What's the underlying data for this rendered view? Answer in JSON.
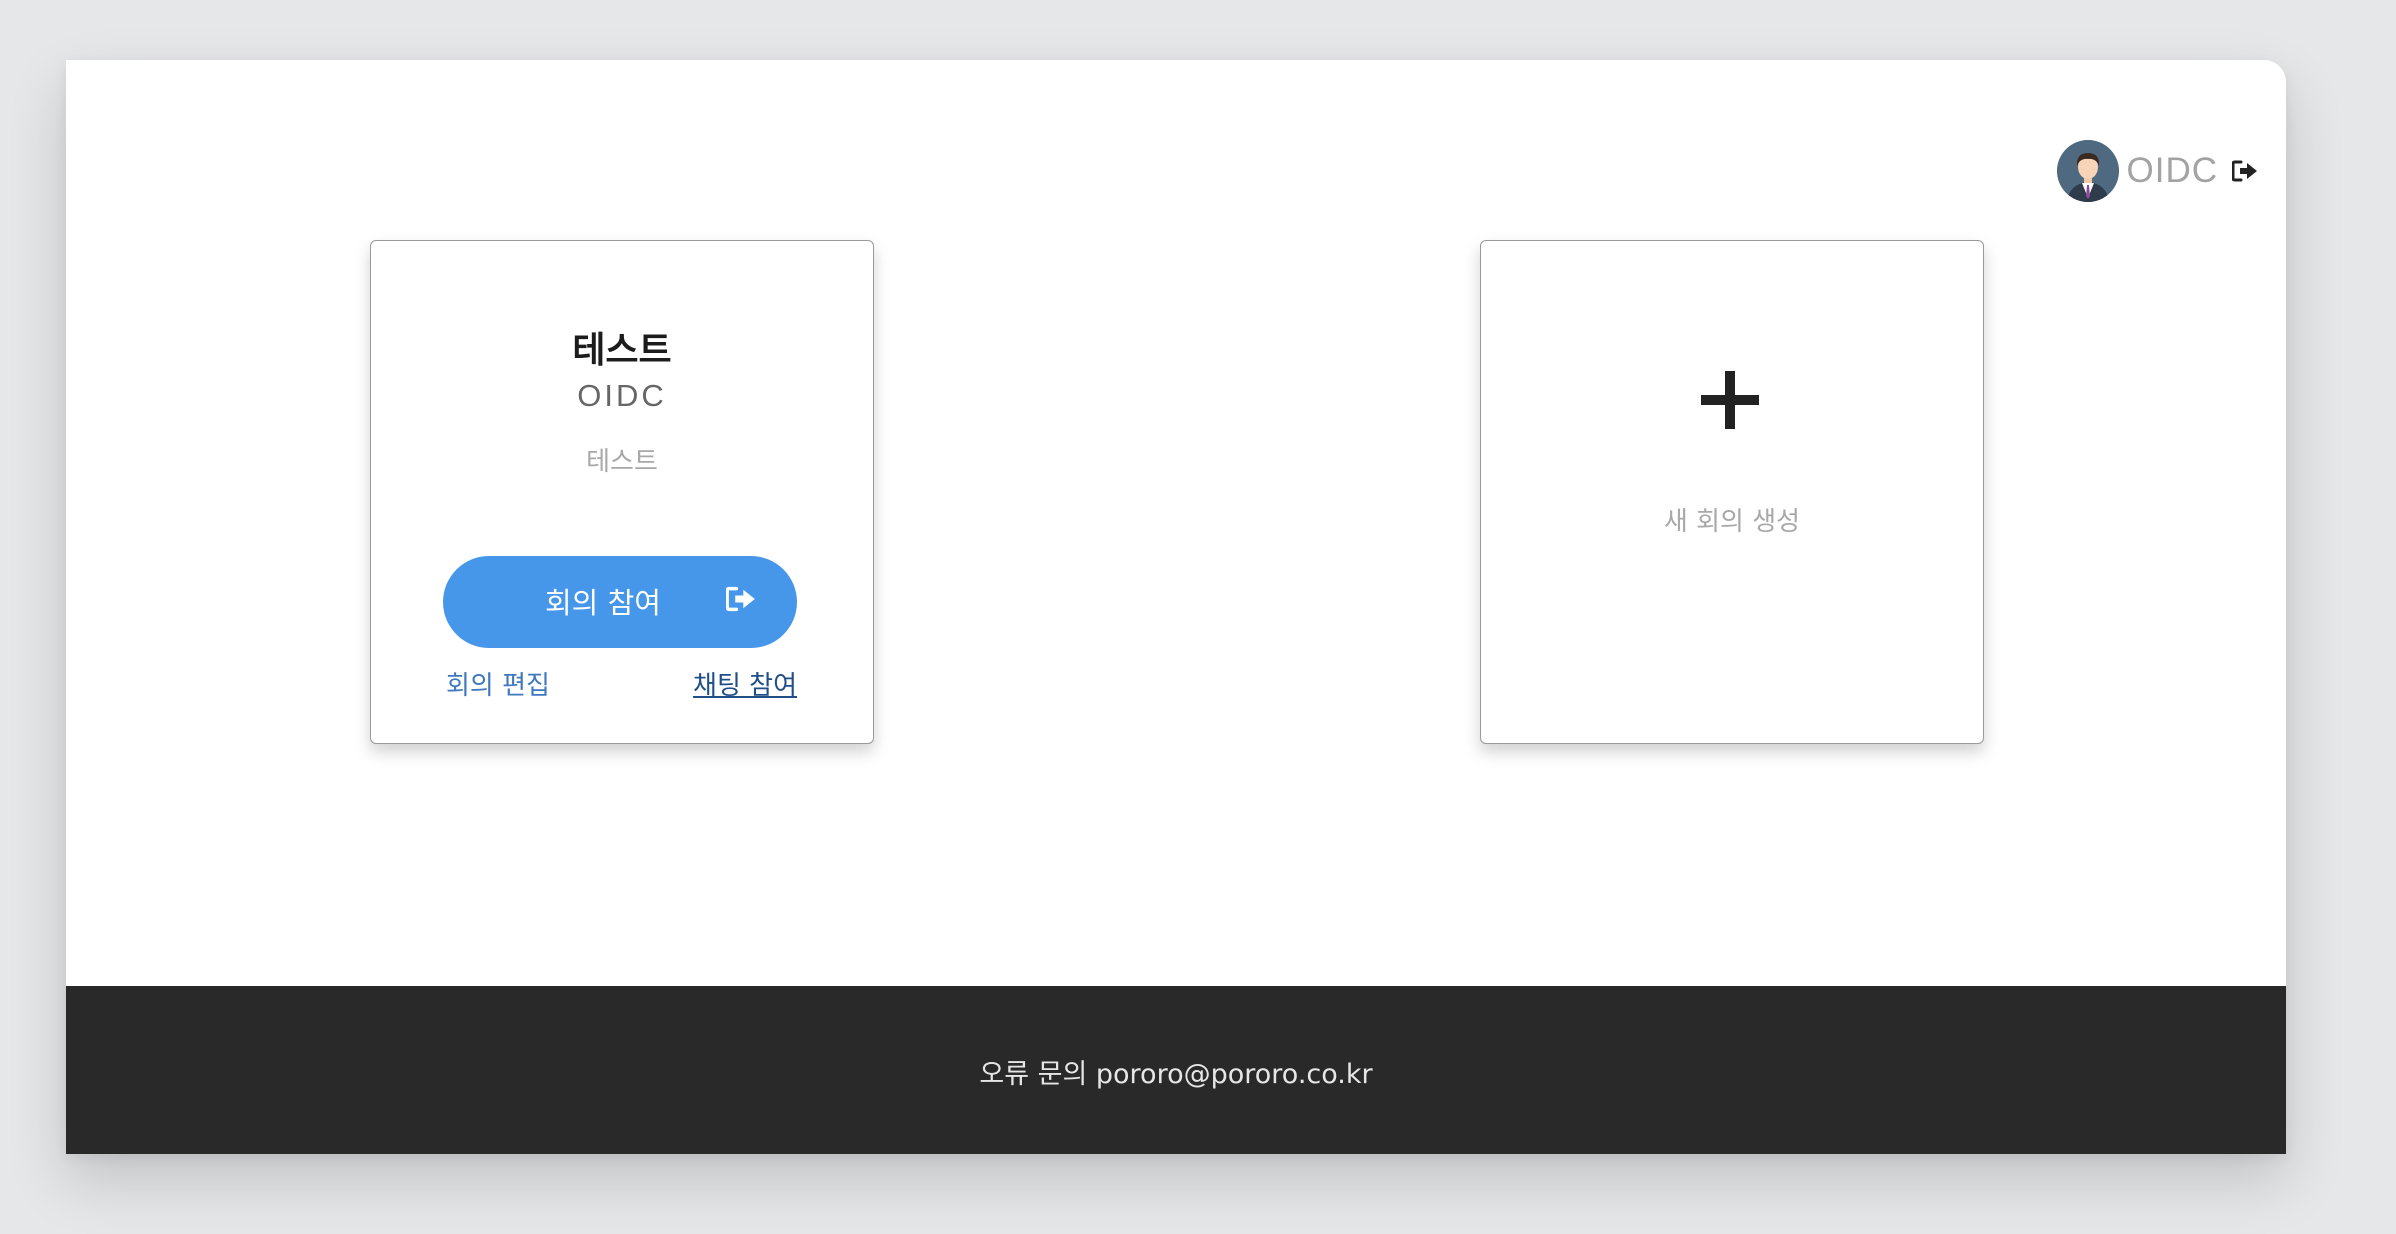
{
  "user": {
    "name": "OIDC",
    "avatar_icon": "user-avatar",
    "logout_icon": "sign-out-icon"
  },
  "meeting_card": {
    "title": "테스트",
    "host": "OIDC",
    "description": "테스트",
    "join_label": "회의 참여",
    "join_icon": "sign-out-icon",
    "edit_label": "회의 편집",
    "chat_label": "채팅 참여"
  },
  "new_meeting_card": {
    "icon": "plus-icon",
    "label": "새 회의 생성"
  },
  "footer": {
    "text": "오류 문의 pororo@pororo.co.kr"
  },
  "colors": {
    "accent": "#4696ea",
    "footer_bg": "#292929",
    "link": "#3f78bf"
  }
}
